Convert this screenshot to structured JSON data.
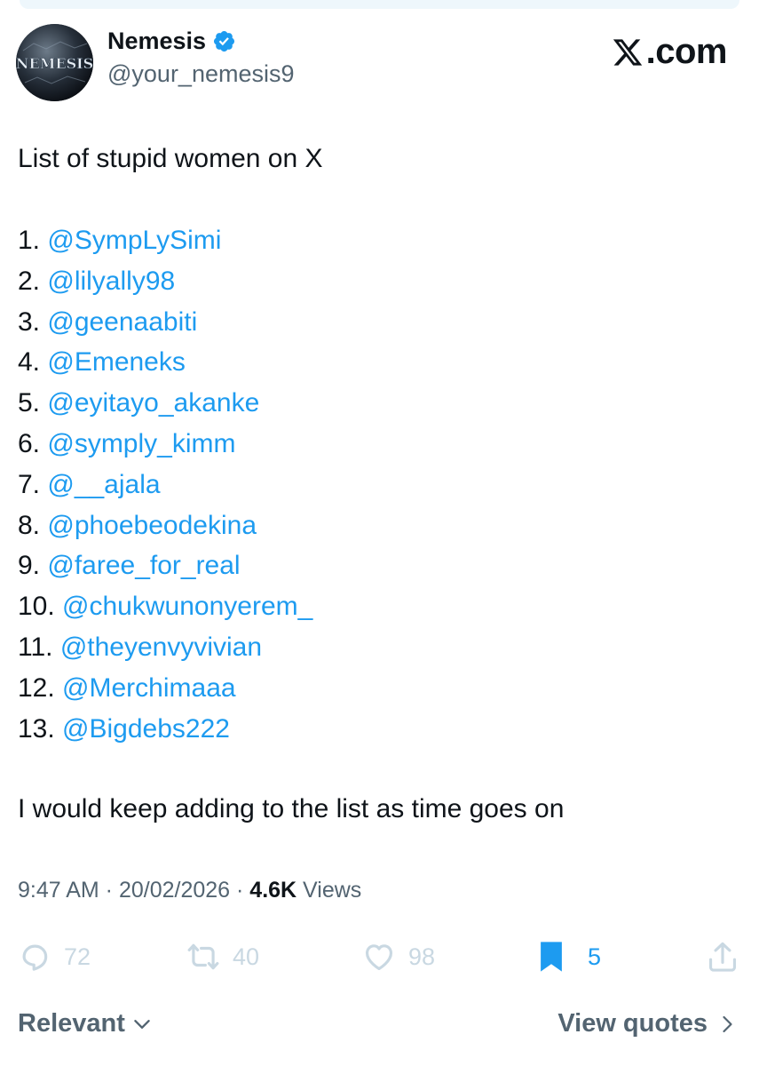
{
  "author": {
    "name": "Nemesis",
    "handle": "@your_nemesis9",
    "verified": true,
    "avatar_text": "NEMESIS"
  },
  "brand": {
    "logo": "x-logo-icon",
    "text": ".com"
  },
  "tweet": {
    "intro": "List of stupid women on X",
    "list": [
      {
        "num": "1. ",
        "handle": "@SympLySimi"
      },
      {
        "num": "2. ",
        "handle": "@lilyally98"
      },
      {
        "num": "3. ",
        "handle": "@geenaabiti"
      },
      {
        "num": "4. ",
        "handle": "@Emeneks"
      },
      {
        "num": "5. ",
        "handle": "@eyitayo_akanke"
      },
      {
        "num": "6. ",
        "handle": "@symply_kimm"
      },
      {
        "num": "7. ",
        "handle": "@__ajala"
      },
      {
        "num": "8. ",
        "handle": "@phoebeodekina"
      },
      {
        "num": "9. ",
        "handle": "@faree_for_real"
      },
      {
        "num": "10. ",
        "handle": "@chukwunonyerem_"
      },
      {
        "num": "11. ",
        "handle": "@theyenvyvivian"
      },
      {
        "num": "12. ",
        "handle": "@Merchimaaa"
      },
      {
        "num": "13. ",
        "handle": "@Bigdebs222"
      }
    ],
    "outro": "I would keep adding to the list as time goes on"
  },
  "meta": {
    "time": "9:47 AM",
    "sep": " · ",
    "date": "20/02/2026",
    "views_count": "4.6K",
    "views_label": " Views"
  },
  "actions": {
    "replies": "72",
    "reposts": "40",
    "likes": "98",
    "bookmarks": "5"
  },
  "footer": {
    "sort_label": "Relevant",
    "quotes_label": "View quotes"
  },
  "colors": {
    "link": "#1d9bf0",
    "secondary_text": "#536471",
    "faded_icon": "#c9d8e2",
    "text": "#0f1419"
  }
}
